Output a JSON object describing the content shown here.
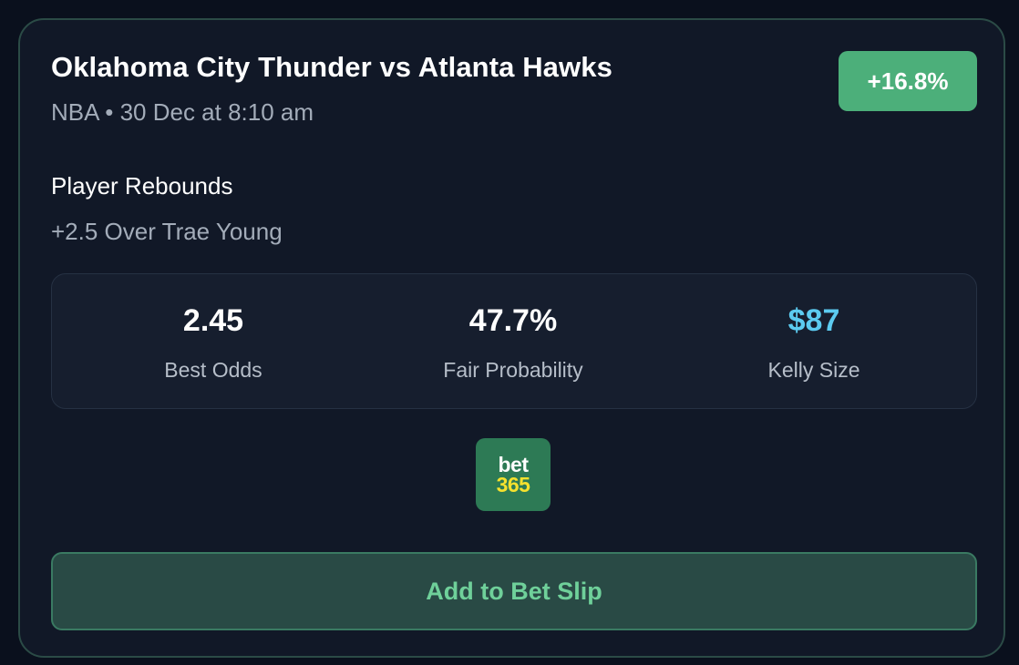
{
  "card": {
    "title": "Oklahoma City Thunder vs Atlanta Hawks",
    "meta": "NBA • 30 Dec at 8:10 am",
    "edge_badge": "+16.8%",
    "market": "Player Rebounds",
    "selection": "+2.5 Over Trae Young",
    "stats": [
      {
        "value": "2.45",
        "label": "Best Odds"
      },
      {
        "value": "47.7%",
        "label": "Fair Probability"
      },
      {
        "value": "$87",
        "label": "Kelly Size"
      }
    ],
    "bookmaker": {
      "logo_top": "bet",
      "logo_bottom": "365"
    },
    "add_button_label": "Add to Bet Slip"
  },
  "colors": {
    "badge_green": "#4caf7a",
    "kelly_blue": "#5ccbf0",
    "button_text_green": "#6fd09a"
  }
}
